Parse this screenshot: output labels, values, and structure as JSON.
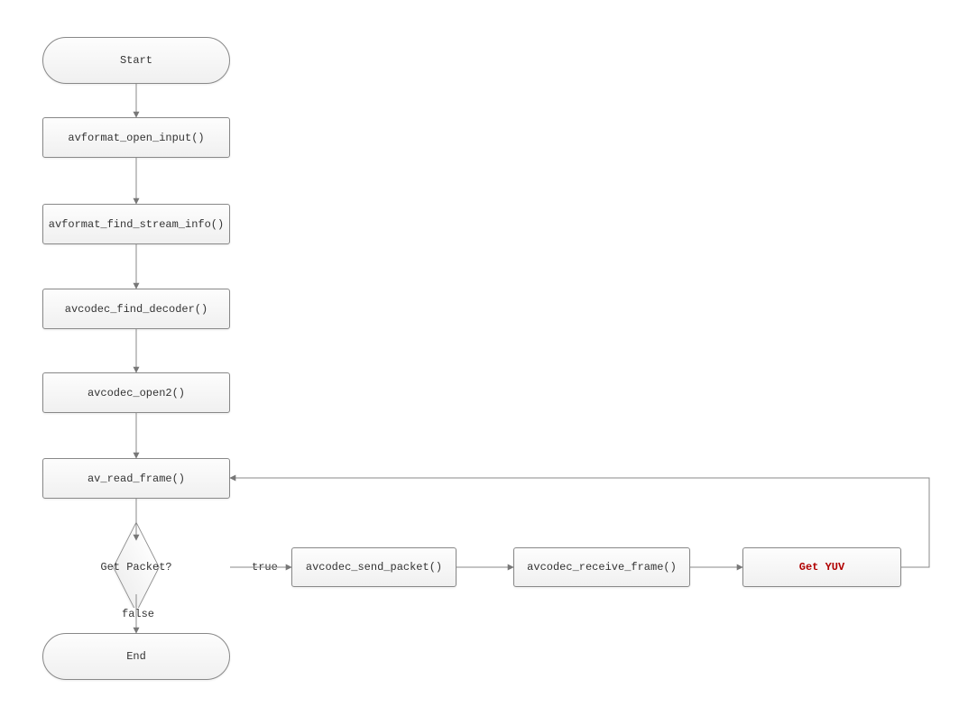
{
  "nodes": {
    "start": {
      "label": "Start"
    },
    "open_input": {
      "label": "avformat_open_input()"
    },
    "find_stream": {
      "label": "avformat_find_stream_info()"
    },
    "find_dec": {
      "label": "avcodec_find_decoder()"
    },
    "open2": {
      "label": "avcodec_open2()"
    },
    "read_frame": {
      "label": "av_read_frame()"
    },
    "decision": {
      "label": "Get Packet?"
    },
    "send_pkt": {
      "label": "avcodec_send_packet()"
    },
    "recv_frame": {
      "label": "avcodec_receive_frame()"
    },
    "get_yuv": {
      "label": "Get YUV"
    },
    "end": {
      "label": "End"
    }
  },
  "edges": {
    "true_label": "true",
    "false_label": "false"
  },
  "chart_data": {
    "type": "flowchart",
    "nodes": [
      {
        "id": "start",
        "type": "terminator",
        "label": "Start"
      },
      {
        "id": "open_input",
        "type": "process",
        "label": "avformat_open_input()"
      },
      {
        "id": "find_stream",
        "type": "process",
        "label": "avformat_find_stream_info()"
      },
      {
        "id": "find_dec",
        "type": "process",
        "label": "avcodec_find_decoder()"
      },
      {
        "id": "open2",
        "type": "process",
        "label": "avcodec_open2()"
      },
      {
        "id": "read_frame",
        "type": "process",
        "label": "av_read_frame()"
      },
      {
        "id": "decision",
        "type": "decision",
        "label": "Get Packet?"
      },
      {
        "id": "send_pkt",
        "type": "process",
        "label": "avcodec_send_packet()"
      },
      {
        "id": "recv_frame",
        "type": "process",
        "label": "avcodec_receive_frame()"
      },
      {
        "id": "get_yuv",
        "type": "process",
        "label": "Get YUV",
        "emphasis": true
      },
      {
        "id": "end",
        "type": "terminator",
        "label": "End"
      }
    ],
    "edges": [
      {
        "from": "start",
        "to": "open_input"
      },
      {
        "from": "open_input",
        "to": "find_stream"
      },
      {
        "from": "find_stream",
        "to": "find_dec"
      },
      {
        "from": "find_dec",
        "to": "open2"
      },
      {
        "from": "open2",
        "to": "read_frame"
      },
      {
        "from": "read_frame",
        "to": "decision"
      },
      {
        "from": "decision",
        "to": "send_pkt",
        "label": "true"
      },
      {
        "from": "send_pkt",
        "to": "recv_frame"
      },
      {
        "from": "recv_frame",
        "to": "get_yuv"
      },
      {
        "from": "get_yuv",
        "to": "read_frame",
        "loopback": true
      },
      {
        "from": "decision",
        "to": "end",
        "label": "false"
      }
    ]
  }
}
